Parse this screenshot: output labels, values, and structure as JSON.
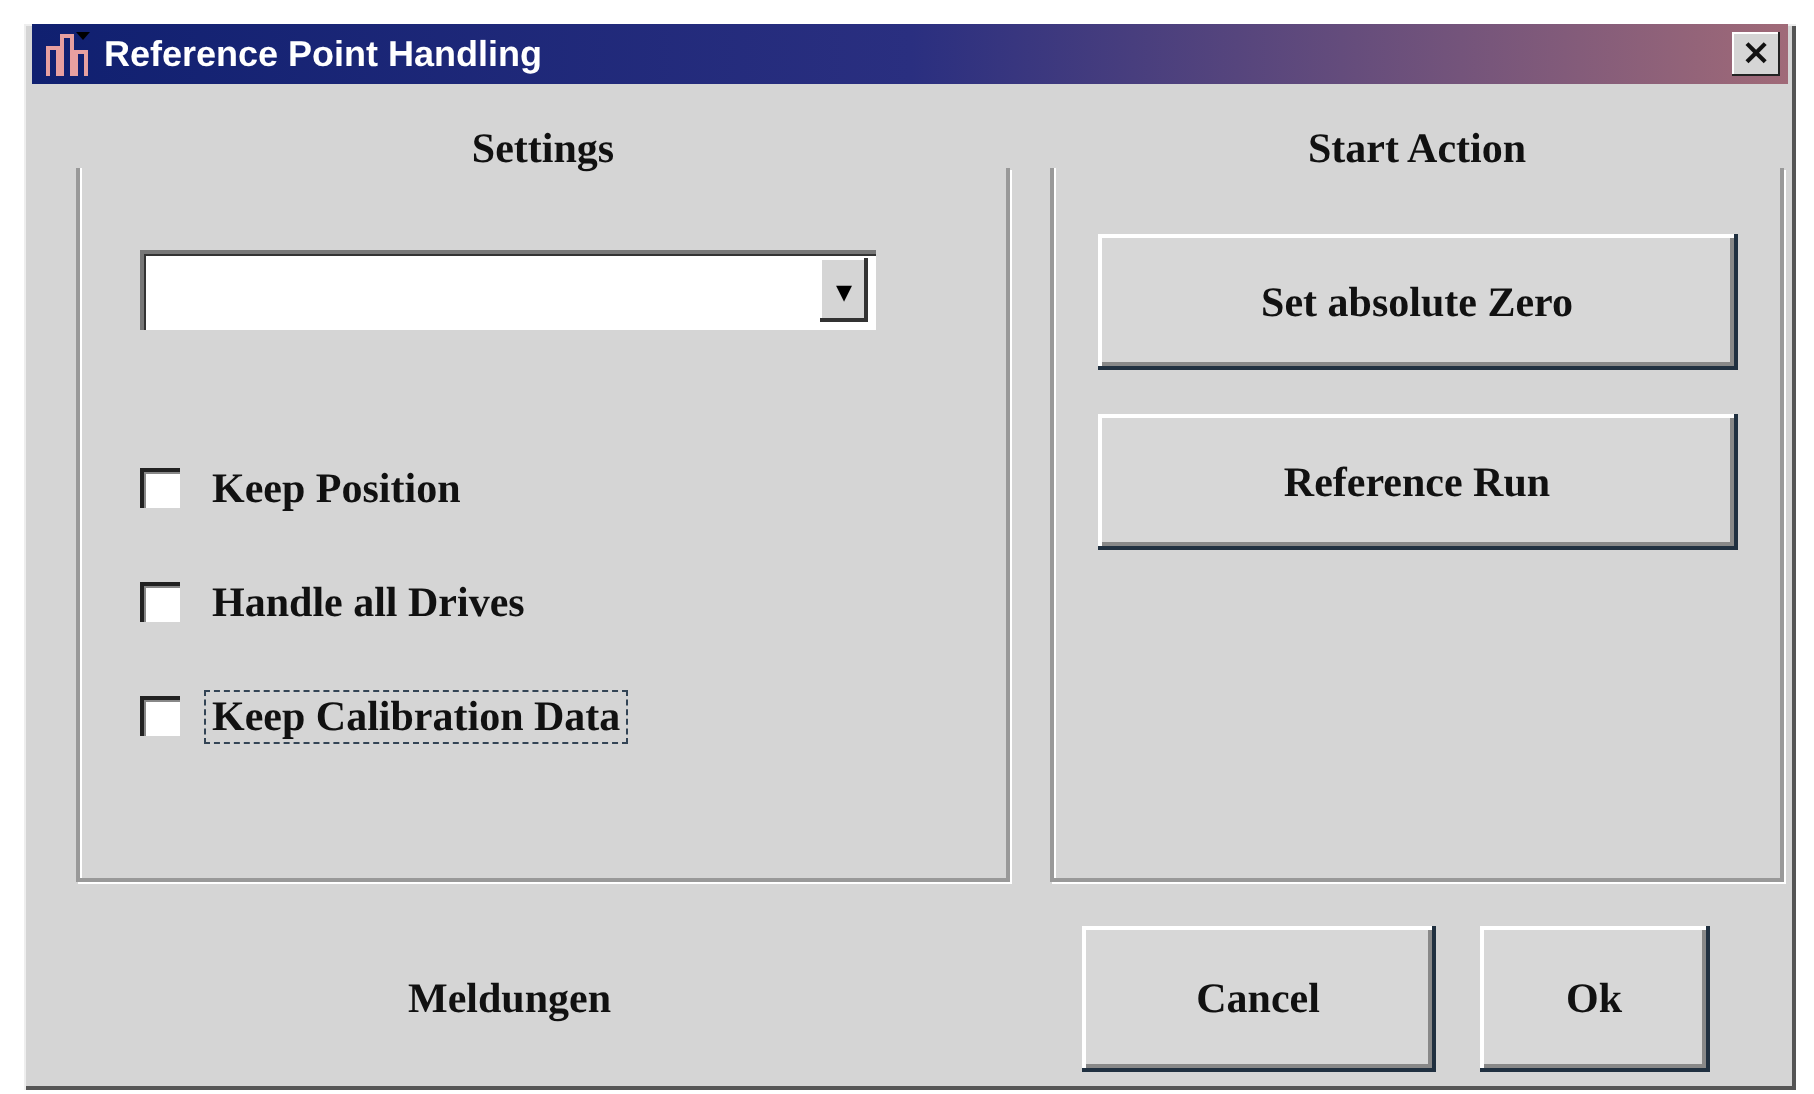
{
  "window": {
    "title": "Reference Point Handling",
    "close": "×"
  },
  "settings": {
    "title": "Settings",
    "dropdown": {
      "arrow": "▾"
    },
    "checkboxes": [
      {
        "label": "Keep Position",
        "checked": false,
        "focused": false
      },
      {
        "label": "Handle all Drives",
        "checked": false,
        "focused": false
      },
      {
        "label": "Keep Calibration Data",
        "checked": false,
        "focused": true
      }
    ]
  },
  "start_action": {
    "title": "Start Action",
    "buttons": [
      "Set absolute Zero",
      "Reference Run"
    ]
  },
  "messages_label": "Meldungen",
  "buttons": [
    "Cancel",
    "Ok"
  ]
}
